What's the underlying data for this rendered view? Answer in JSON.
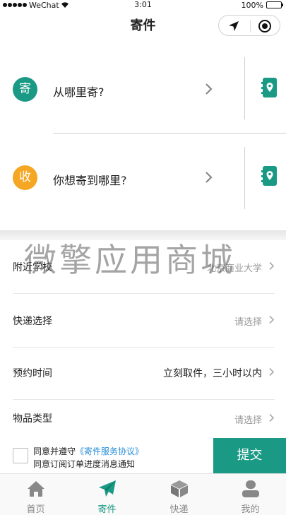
{
  "status_bar": {
    "carrier": "WeChat",
    "time": "3:01",
    "battery_percent": "100%",
    "battery_level": 1.0
  },
  "nav": {
    "title": "寄件"
  },
  "address": {
    "send": {
      "badge": "寄",
      "placeholder": "从哪里寄?"
    },
    "receive": {
      "badge": "收",
      "placeholder": "你想寄到哪里?"
    }
  },
  "watermark": "微擎应用商城",
  "form": {
    "rows": [
      {
        "label": "附近学校",
        "value": "北京商业大学"
      },
      {
        "label": "快递选择",
        "value": "请选择"
      },
      {
        "label": "预约时间",
        "value": "立刻取件，三小时以内"
      },
      {
        "label": "物品类型",
        "value": "请选择"
      }
    ]
  },
  "agreement": {
    "prefix": "同意并遵守",
    "link": "《寄件服务协议》",
    "line2": "同意订阅订单进度消息通知"
  },
  "submit_label": "提交",
  "tabs": [
    {
      "label": "首页",
      "icon": "home-icon"
    },
    {
      "label": "寄件",
      "icon": "send-plane-icon"
    },
    {
      "label": "快递",
      "icon": "package-box-icon"
    },
    {
      "label": "我的",
      "icon": "user-icon"
    }
  ],
  "colors": {
    "accent": "#1a9a84",
    "receive_badge": "#f5a623",
    "link": "#2a8fd8"
  }
}
